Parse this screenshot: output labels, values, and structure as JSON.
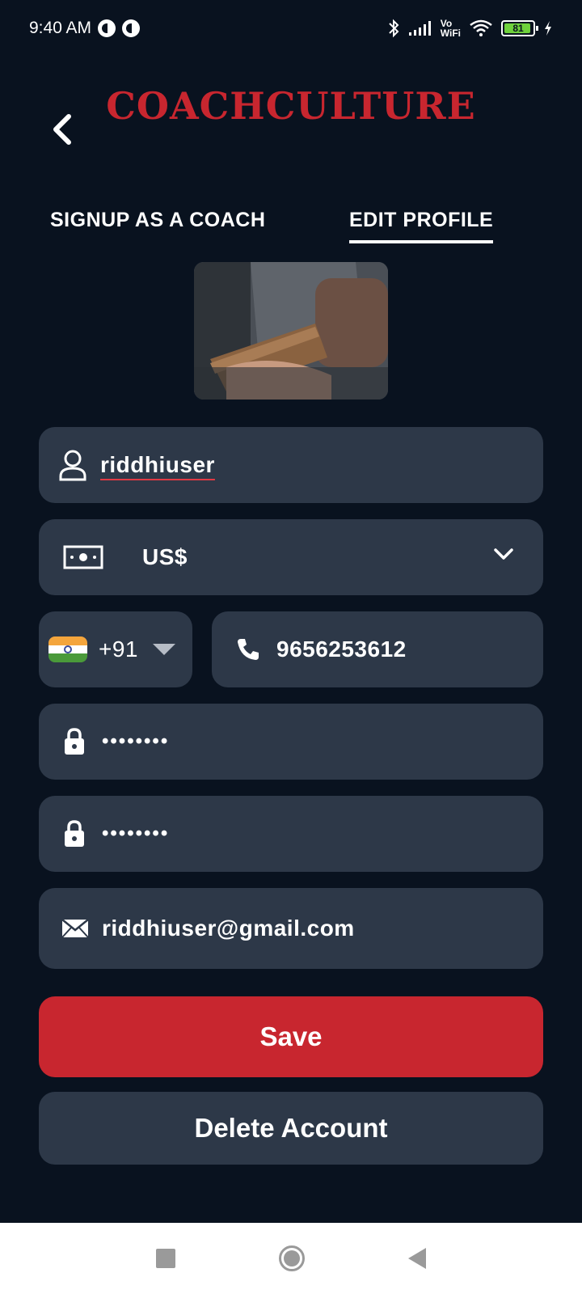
{
  "status_bar": {
    "time": "9:40 AM",
    "network_label_top": "Vo",
    "network_label_bottom": "WiFi",
    "battery_level": "81"
  },
  "header": {
    "logo_text": "COACHCULTURE"
  },
  "tabs": [
    {
      "label": "SIGNUP AS A COACH",
      "active": false
    },
    {
      "label": "EDIT PROFILE",
      "active": true
    }
  ],
  "form": {
    "username": "riddhiuser",
    "currency": "US$",
    "country_code": "+91",
    "phone": "9656253612",
    "password": "••••••••",
    "confirm_password": "••••••••",
    "email": "riddhiuser@gmail.com"
  },
  "buttons": {
    "save_label": "Save",
    "delete_label": "Delete Account"
  },
  "colors": {
    "background": "#09121f",
    "field": "#2d3848",
    "accent": "#c8262f"
  }
}
